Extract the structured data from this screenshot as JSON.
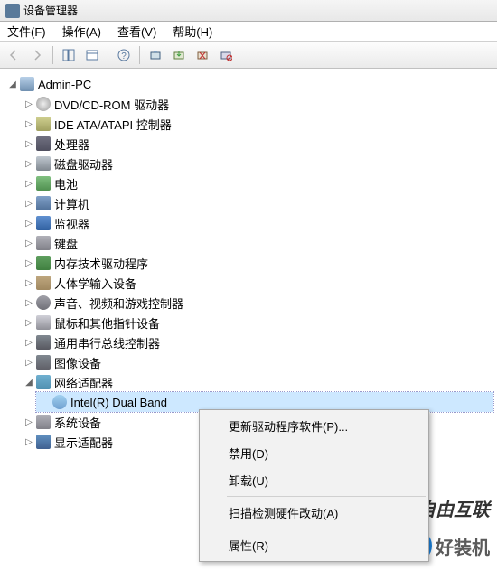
{
  "window": {
    "title": "设备管理器"
  },
  "menubar": [
    {
      "label": "文件(F)"
    },
    {
      "label": "操作(A)"
    },
    {
      "label": "查看(V)"
    },
    {
      "label": "帮助(H)"
    }
  ],
  "tree": {
    "root": {
      "label": "Admin-PC",
      "expanded": true
    },
    "nodes": [
      {
        "label": "DVD/CD-ROM 驱动器",
        "icon": "dvd"
      },
      {
        "label": "IDE ATA/ATAPI 控制器",
        "icon": "ide"
      },
      {
        "label": "处理器",
        "icon": "cpu"
      },
      {
        "label": "磁盘驱动器",
        "icon": "disk"
      },
      {
        "label": "电池",
        "icon": "battery"
      },
      {
        "label": "计算机",
        "icon": "pc"
      },
      {
        "label": "监视器",
        "icon": "monitor"
      },
      {
        "label": "键盘",
        "icon": "keyboard"
      },
      {
        "label": "内存技术驱动程序",
        "icon": "memory"
      },
      {
        "label": "人体学输入设备",
        "icon": "hid"
      },
      {
        "label": "声音、视频和游戏控制器",
        "icon": "sound"
      },
      {
        "label": "鼠标和其他指针设备",
        "icon": "mouse"
      },
      {
        "label": "通用串行总线控制器",
        "icon": "usb"
      },
      {
        "label": "图像设备",
        "icon": "image"
      }
    ],
    "network_adapter": {
      "label": "网络适配器",
      "expanded": true,
      "child": {
        "label": "Intel(R) Dual Band",
        "icon": "netcard",
        "selected": true
      }
    },
    "nodes_after": [
      {
        "label": "系统设备",
        "icon": "system"
      },
      {
        "label": "显示适配器",
        "icon": "display"
      }
    ]
  },
  "context_menu": {
    "update": "更新驱动程序软件(P)...",
    "disable": "禁用(D)",
    "uninstall": "卸载(U)",
    "scan": "扫描检测硬件改动(A)",
    "properties": "属性(R)"
  },
  "watermark": {
    "text1": "自由互联",
    "text2": "好装机"
  }
}
